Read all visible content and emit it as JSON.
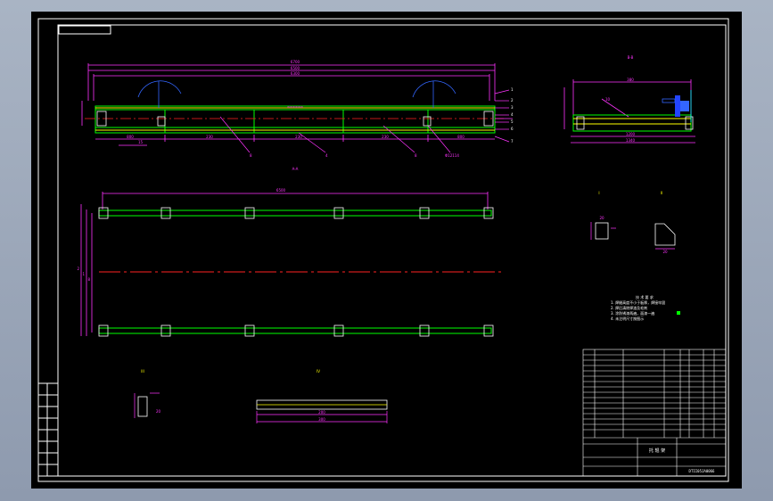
{
  "canvas": {
    "background": "#000000",
    "line_colors": {
      "frame": "#ffffff",
      "dimension": "#ff33ff",
      "outline": "#00ff00",
      "centerline": "#ff2222",
      "annotation": "#ffff00",
      "part": "#00ffff",
      "accent": "#3366ff"
    }
  },
  "views": {
    "main": {
      "dims_top": [
        "6700",
        "6500",
        "6300"
      ],
      "dims_bottom": [
        "800",
        "230",
        "230",
        "230",
        "800"
      ],
      "midlabel": "WWWWWW",
      "balloons": [
        "1",
        "2",
        "3",
        "4",
        "5",
        "6",
        "7"
      ],
      "leaders": [
        "8",
        "4",
        "8",
        "Φ12114",
        "15"
      ]
    },
    "section_label": "A-A",
    "aa": {
      "title": "B-B",
      "dims": [
        "380",
        "10",
        "1200",
        "1340"
      ]
    },
    "plan": {
      "top_dim": "6500",
      "left_dims": [
        "2",
        "1",
        "8"
      ]
    },
    "detail1": {
      "title": "I",
      "dim": "20"
    },
    "detail2": {
      "title": "II",
      "dim": "20"
    },
    "detail3": {
      "title": "III",
      "dim": "20"
    },
    "detail4": {
      "title": "IV",
      "dims": [
        "200",
        "300"
      ]
    }
  },
  "notes": {
    "title": "技 术 要 求",
    "lines": [
      "1. 焊缝高度不小于板厚，焊接牢固",
      "2. 焊后清除焊渣及毛刺",
      "3. 涂防锈漆两遍，面漆一遍",
      "4. 未注明尺寸按图示"
    ]
  },
  "title_block": {
    "name": "托 辊 架",
    "drawing_no": "DTII05JA0066"
  }
}
